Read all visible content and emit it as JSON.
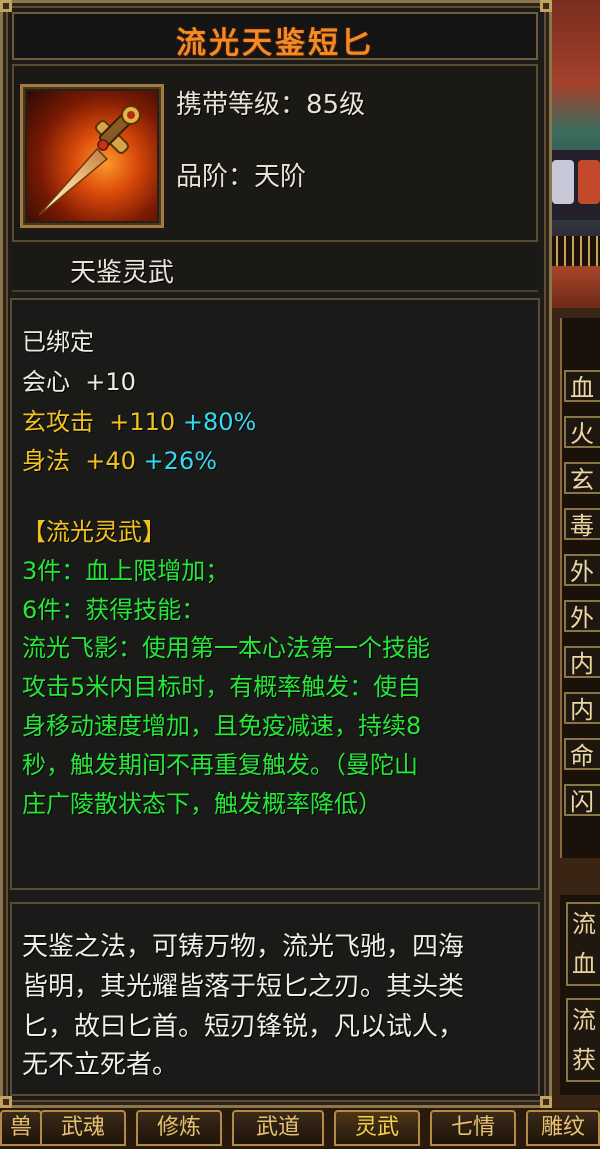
{
  "item": {
    "name": "流光天鉴短匕",
    "carry_level": "携带等级：85级",
    "grade": "品阶：天阶",
    "series": "天鉴灵武",
    "icon": "dagger-icon"
  },
  "stats": {
    "bound": "已绑定",
    "lines": [
      {
        "label": "会心",
        "base": "+10",
        "pct": ""
      },
      {
        "label": "玄攻击",
        "base": "+110",
        "pct": "+80%"
      },
      {
        "label": "身法",
        "base": "+40",
        "pct": "+26%"
      }
    ]
  },
  "set": {
    "title": "【流光灵武】",
    "lines": [
      "3件：血上限增加；",
      "6件：获得技能：",
      "流光飞影：使用第一本心法第一个技能",
      "攻击5米内目标时，有概率触发：使自",
      "身移动速度增加，且免疫减速，持续8",
      "秒，触发期间不再重复触发。（曼陀山",
      "庄广陵散状态下，触发概率降低）"
    ]
  },
  "description": [
    "天鉴之法，可铸万物，流光飞驰，四海",
    "皆明，其光耀皆落于短匕之刃。其头类",
    "匕，故曰匕首。短刃锋锐，凡以试人，",
    "无不立死者。"
  ],
  "side_attributes": [
    "血",
    "火",
    "玄",
    "毒",
    "外",
    "外",
    "内",
    "内",
    "命",
    "闪"
  ],
  "side_cards": [
    {
      "line1": "流",
      "line2": "血"
    },
    {
      "line1": "流",
      "line2": "获"
    }
  ],
  "tabs": [
    {
      "label": "兽"
    },
    {
      "label": "武魂"
    },
    {
      "label": "修炼"
    },
    {
      "label": "武道"
    },
    {
      "label": "灵武",
      "active": true
    },
    {
      "label": "七情"
    },
    {
      "label": "雕纹"
    }
  ],
  "colors": {
    "title": "#f28a28",
    "gold": "#f1c21f",
    "cyan": "#35d8ee",
    "green": "#27e63a",
    "frame": "#8c7650"
  }
}
